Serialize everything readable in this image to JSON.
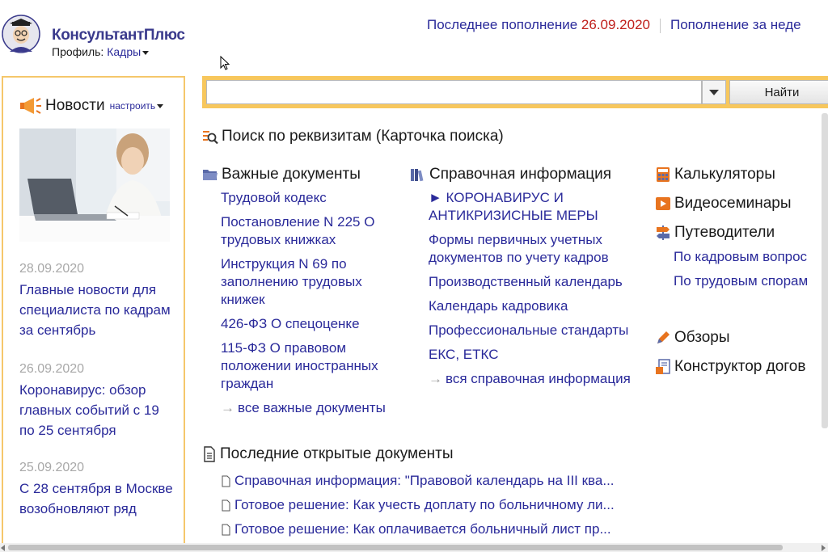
{
  "header": {
    "brand": "КонсультантПлюс",
    "profile_label": "Профиль:",
    "profile_value": "Кадры",
    "last_update_label": "Последнее пополнение",
    "last_update_date": "26.09.2020",
    "week_update_label": "Пополнение за неде"
  },
  "search": {
    "value": "",
    "button_label": "Найти"
  },
  "news": {
    "title": "Новости",
    "configure_label": "настроить",
    "items": [
      {
        "date": "28.09.2020",
        "text": "Главные новости для специалиста по кадрам за сентябрь"
      },
      {
        "date": "26.09.2020",
        "text": "Коронавирус: обзор главных событий с 19 по 25 сентября"
      },
      {
        "date": "25.09.2020",
        "text": "С 28 сентября в Москве возобновляют ряд"
      }
    ]
  },
  "card_search": {
    "title": "Поиск по реквизитам (Карточка поиска)"
  },
  "important_docs": {
    "title": "Важные документы",
    "items": [
      "Трудовой кодекс",
      "Постановление N 225 О трудовых книжках",
      "Инструкция N 69 по заполнению трудовых книжек",
      "426-ФЗ О спецоценке",
      "115-ФЗ О правовом положении иностранных граждан"
    ],
    "more_label": "все важные документы"
  },
  "reference_info": {
    "title": "Справочная информация",
    "items": [
      "► КОРОНАВИРУС И АНТИКРИЗИСНЫЕ МЕРЫ",
      "Формы первичных учетных документов по учету кадров",
      "Производственный календарь",
      "Календарь кадровика",
      "Профессиональные стандарты",
      "ЕКС, ЕТКС"
    ],
    "more_label": "вся справочная информация"
  },
  "right_column": {
    "calculators": "Калькуляторы",
    "video_seminars": "Видеосеминары",
    "guides": "Путеводители",
    "guide_links": [
      "По кадровым вопрос",
      "По трудовым спорам"
    ],
    "reviews": "Обзоры",
    "contract_builder": "Конструктор догов"
  },
  "recent_docs": {
    "title": "Последние открытые документы",
    "items": [
      "Справочная информация: \"Правовой календарь на III ква...",
      "Готовое решение: Как учесть доплату по больничному ли...",
      "Готовое решение: Как оплачивается больничный лист пр..."
    ]
  },
  "colors": {
    "link": "#2a2a9a",
    "date_red": "#c0201c",
    "search_frame": "#f7c75d",
    "sidebar_border": "#f5c76b",
    "news_date": "#a8a8a8"
  }
}
